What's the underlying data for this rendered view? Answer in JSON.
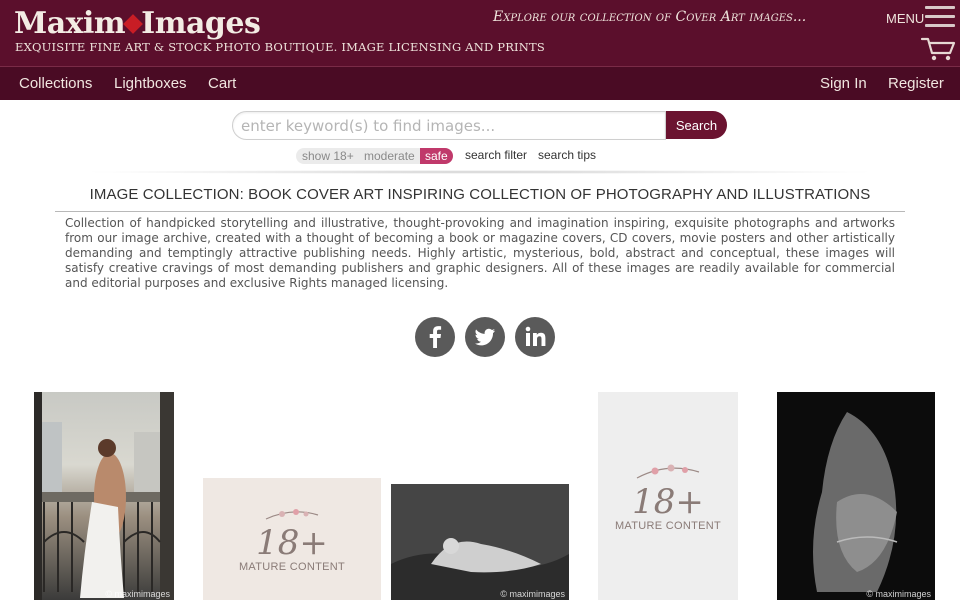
{
  "header": {
    "logo_text_left": "Maxim",
    "logo_text_right": "Images",
    "tagline": "EXQUISITE FINE ART & STOCK PHOTO BOUTIQUE. IMAGE LICENSING AND PRINTS",
    "explore_text": "Explore our collection of Cover Art images...",
    "menu_label": "MENU",
    "brand_color": "#5b0f2c"
  },
  "nav": {
    "collections": "Collections",
    "lightboxes": "Lightboxes",
    "cart": "Cart",
    "sign_in": "Sign In",
    "register": "Register"
  },
  "search": {
    "placeholder": "enter keyword(s) to find images...",
    "button_label": "Search",
    "filter_show18": "show 18+",
    "filter_moderate": "moderate",
    "filter_safe": "safe",
    "search_filter": "search filter",
    "search_tips": "search tips"
  },
  "page": {
    "title": "IMAGE COLLECTION: BOOK COVER ART INSPIRING COLLECTION OF PHOTOGRAPHY AND ILLUSTRATIONS",
    "description": "Collection of handpicked storytelling and illustrative, thought-provoking and imagination inspiring, exquisite photographs and artworks from our image archive, created with a thought of becoming a book or magazine covers, CD covers, movie posters and other artistically demanding and temptingly attractive publishing needs. Highly artistic, mysterious, bold, abstract and conceptual, these images will satisfy creative cravings of most demanding publishers and graphic designers. All of these images are readily available for commercial and editorial purposes and exclusive Rights managed licensing."
  },
  "social": {
    "facebook_icon": "facebook-icon",
    "twitter_icon": "twitter-icon",
    "linkedin_icon": "linkedin-icon"
  },
  "gallery": {
    "watermark": "© maximimages",
    "mature_big": "18+",
    "mature_small": "MATURE CONTENT"
  }
}
